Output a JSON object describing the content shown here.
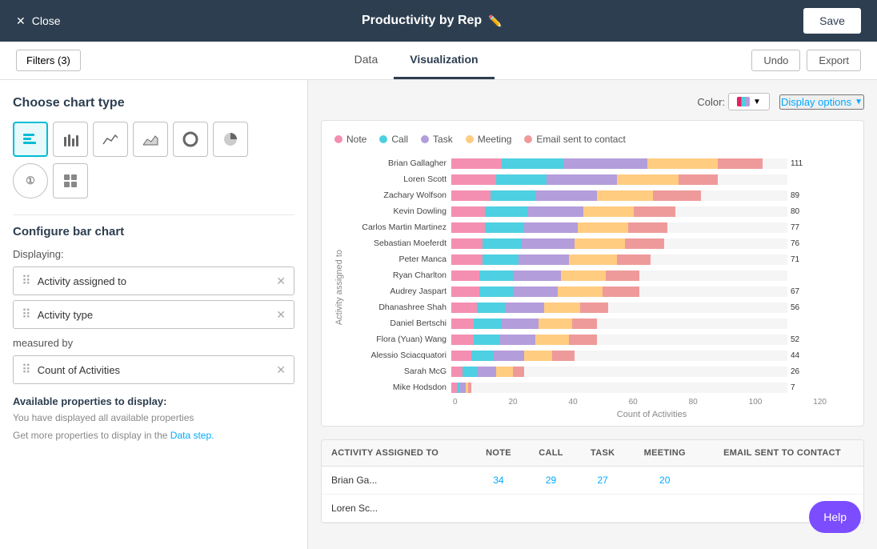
{
  "header": {
    "close_label": "Close",
    "title": "Productivity by Rep",
    "save_label": "Save"
  },
  "toolbar": {
    "filters_label": "Filters (3)",
    "tabs": [
      {
        "label": "Data",
        "active": false
      },
      {
        "label": "Visualization",
        "active": true
      }
    ],
    "undo_label": "Undo",
    "export_label": "Export"
  },
  "sidebar": {
    "chart_type_title": "Choose chart type",
    "config_title": "Configure bar chart",
    "displaying_label": "Displaying:",
    "display_tags": [
      {
        "label": "Activity assigned to"
      },
      {
        "label": "Activity type"
      }
    ],
    "measured_by_label": "measured by",
    "measure_tag": {
      "label": "Count of Activities"
    },
    "available_title": "Available properties to display:",
    "available_info": "You have displayed all available properties",
    "data_step_text": "Get more properties to display in the",
    "data_step_link": "Data step."
  },
  "chart": {
    "color_label": "Color:",
    "display_options_label": "Display options",
    "legend": [
      {
        "label": "Note",
        "color": "#f48fb1"
      },
      {
        "label": "Call",
        "color": "#4dd0e1"
      },
      {
        "label": "Task",
        "color": "#b39ddb"
      },
      {
        "label": "Meeting",
        "color": "#ffcc80"
      },
      {
        "label": "Email sent to contact",
        "color": "#ef9a9a"
      }
    ],
    "y_axis_title": "Activity assigned to",
    "x_axis_title": "Count of Activities",
    "x_axis_labels": [
      "0",
      "20",
      "40",
      "60",
      "80",
      "100",
      "120"
    ],
    "bars": [
      {
        "name": "Brian Gallagher",
        "total": 111,
        "note": 18,
        "call": 22,
        "task": 30,
        "meeting": 25,
        "email": 16
      },
      {
        "name": "Loren Scott",
        "total": null,
        "note": 16,
        "call": 18,
        "task": 25,
        "meeting": 22,
        "email": 14
      },
      {
        "name": "Zachary Wolfson",
        "total": 89,
        "note": 14,
        "call": 16,
        "task": 22,
        "meeting": 20,
        "email": 17
      },
      {
        "name": "Kevin Dowling",
        "total": 80,
        "note": 12,
        "call": 15,
        "task": 20,
        "meeting": 18,
        "email": 15
      },
      {
        "name": "Carlos Martin Martinez",
        "total": 77,
        "note": 12,
        "call": 14,
        "task": 19,
        "meeting": 18,
        "email": 14
      },
      {
        "name": "Sebastian Moeferdt",
        "total": 76,
        "note": 11,
        "call": 14,
        "task": 19,
        "meeting": 18,
        "email": 14
      },
      {
        "name": "Peter Manca",
        "total": 71,
        "note": 11,
        "call": 13,
        "task": 18,
        "meeting": 17,
        "email": 12
      },
      {
        "name": "Ryan Charlton",
        "total": null,
        "note": 10,
        "call": 12,
        "task": 17,
        "meeting": 16,
        "email": 12
      },
      {
        "name": "Audrey Jaspart",
        "total": 67,
        "note": 10,
        "call": 12,
        "task": 16,
        "meeting": 16,
        "email": 13
      },
      {
        "name": "Dhanashree Shah",
        "total": 56,
        "note": 9,
        "call": 10,
        "task": 14,
        "meeting": 13,
        "email": 10
      },
      {
        "name": "Daniel Bertschi",
        "total": null,
        "note": 8,
        "call": 10,
        "task": 13,
        "meeting": 12,
        "email": 9
      },
      {
        "name": "Flora (Yuan) Wang",
        "total": 52,
        "note": 8,
        "call": 9,
        "task": 13,
        "meeting": 12,
        "email": 10
      },
      {
        "name": "Alessio Sciacquatori",
        "total": 44,
        "note": 7,
        "call": 8,
        "task": 11,
        "meeting": 10,
        "email": 8
      },
      {
        "name": "Sarah McG",
        "total": 26,
        "note": 4,
        "call": 5,
        "task": 7,
        "meeting": 6,
        "email": 4
      },
      {
        "name": "Mike Hodsdon",
        "total": 7,
        "note": 2,
        "call": 1,
        "task": 2,
        "meeting": 1,
        "email": 1
      }
    ]
  },
  "table": {
    "headers": [
      "ACTIVITY ASSIGNED TO",
      "NOTE",
      "CALL",
      "TASK",
      "MEETING",
      "EMAIL SENT TO CONTACT"
    ],
    "rows": [
      {
        "name": "Brian Ga...",
        "note": 34,
        "call": 29,
        "task": 27,
        "meeting": 20,
        "email": null
      },
      {
        "name": "Loren Sc...",
        "note": null,
        "call": null,
        "task": null,
        "meeting": null,
        "email": null
      }
    ]
  },
  "help_label": "Help"
}
